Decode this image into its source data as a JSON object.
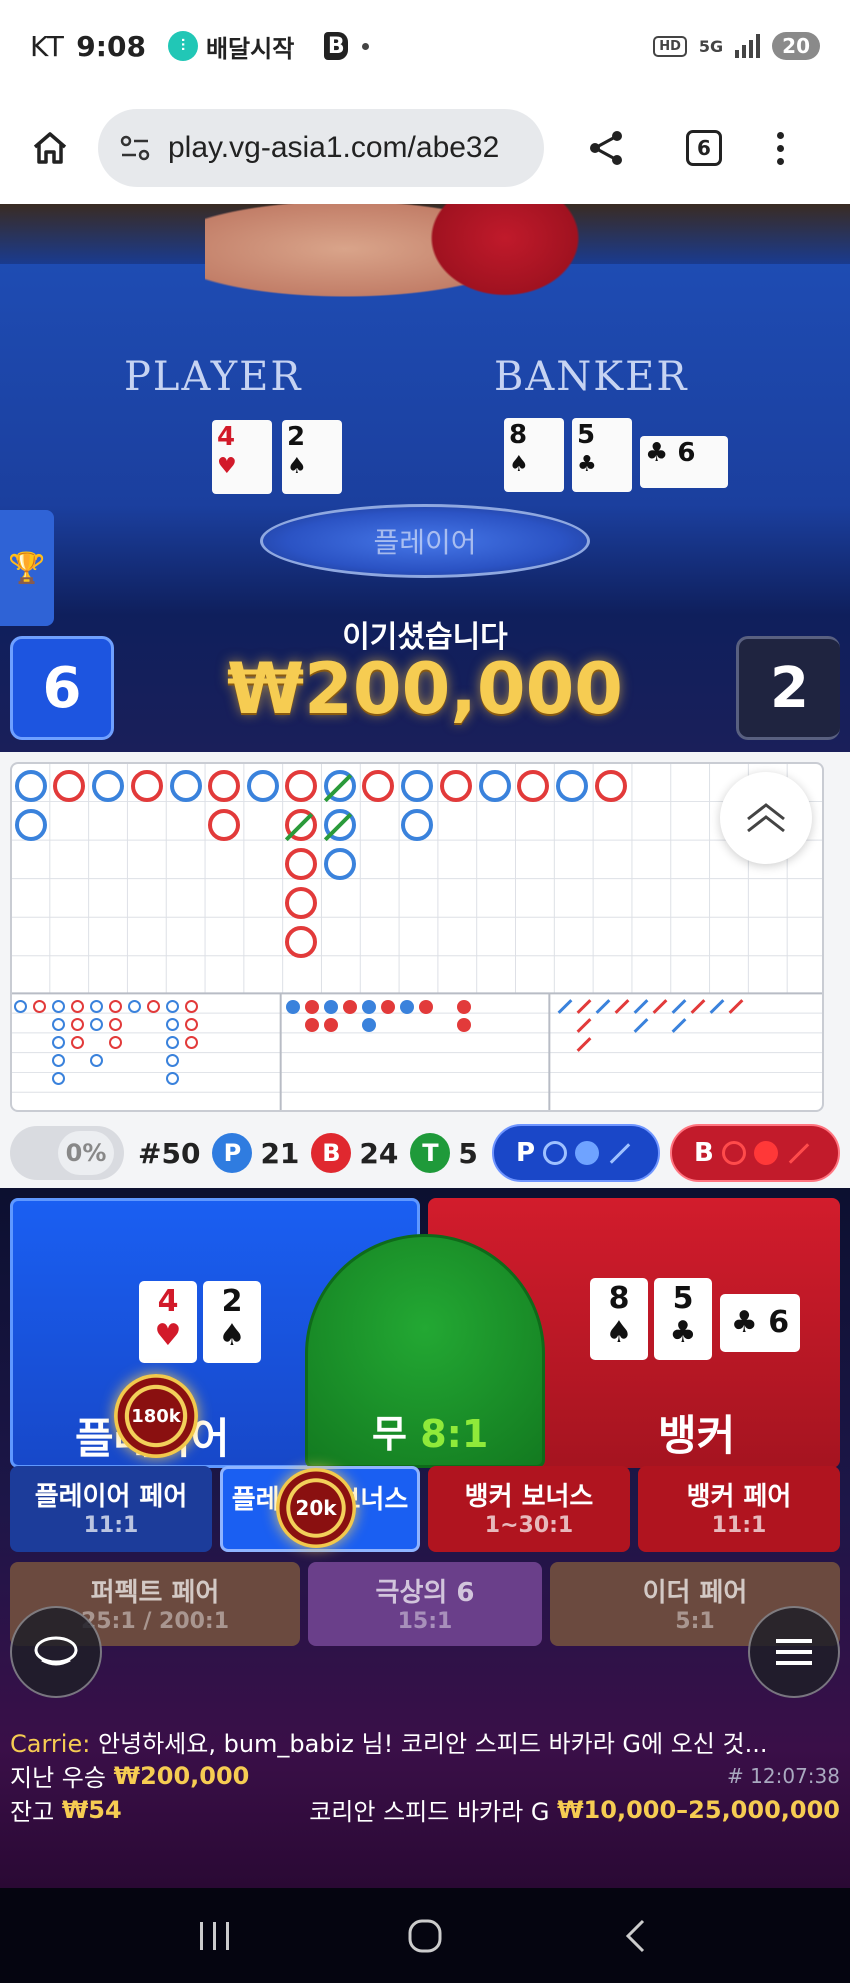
{
  "status_bar": {
    "carrier": "KT",
    "time": "9:08",
    "app_name": "배달시작",
    "battery": "20",
    "hd": "HD",
    "network": "5G"
  },
  "browser": {
    "url": "play.vg-asia1.com/abe32",
    "tab_count": "6"
  },
  "video": {
    "player_label": "PLAYER",
    "banker_label": "BANKER",
    "player_cards": [
      {
        "rank": "4",
        "suit": "♥",
        "color": "red"
      },
      {
        "rank": "2",
        "suit": "♠",
        "color": "black"
      }
    ],
    "banker_cards": [
      {
        "rank": "8",
        "suit": "♠",
        "color": "black"
      },
      {
        "rank": "5",
        "suit": "♣",
        "color": "black"
      },
      {
        "rank": "6",
        "suit": "♣",
        "color": "black"
      }
    ],
    "result_pill": "플레이어",
    "win_title": "이기셨습니다",
    "win_amount": "₩200,000",
    "player_score": "6",
    "banker_score": "2"
  },
  "stats": {
    "percent": "0%",
    "round": "#50",
    "p_label": "P",
    "p_count": "21",
    "b_label": "B",
    "b_count": "24",
    "t_label": "T",
    "t_count": "5",
    "ask_p": "P",
    "ask_b": "B"
  },
  "bets": {
    "player_label": "플레이어",
    "tie_label": "무",
    "tie_odds": "8:1",
    "banker_label": "뱅커",
    "player_chip": "180k",
    "bonus_chip": "20k",
    "side": [
      {
        "name": "플레이어 페어",
        "odds": "11:1"
      },
      {
        "name": "플레이어 보너스",
        "odds": ""
      },
      {
        "name": "뱅커 보너스",
        "odds": "1~30:1"
      },
      {
        "name": "뱅커 페어",
        "odds": "11:1"
      }
    ],
    "extra": [
      {
        "name": "퍼펙트 페어",
        "odds": "25:1 / 200:1"
      },
      {
        "name": "극상의 6",
        "odds": "15:1"
      },
      {
        "name": "이더 페어",
        "odds": "5:1"
      }
    ]
  },
  "chat": {
    "sender": "Carrie:",
    "message": "안녕하세요, bum_babiz 님! 코리안 스피드 바카라 G에 오신 것..."
  },
  "footer": {
    "last_win_label": "지난 우승",
    "last_win_value": "₩200,000",
    "game_id": "# 12:07:38",
    "balance_label": "잔고",
    "balance_value": "₩54",
    "table_name": "코리안 스피드 바카라 G",
    "limits": "₩10,000–25,000,000"
  },
  "colors": {
    "player": "#1a5ff2",
    "banker": "#d21c2c",
    "tie": "#23a833",
    "gold": "#f6cc52"
  }
}
